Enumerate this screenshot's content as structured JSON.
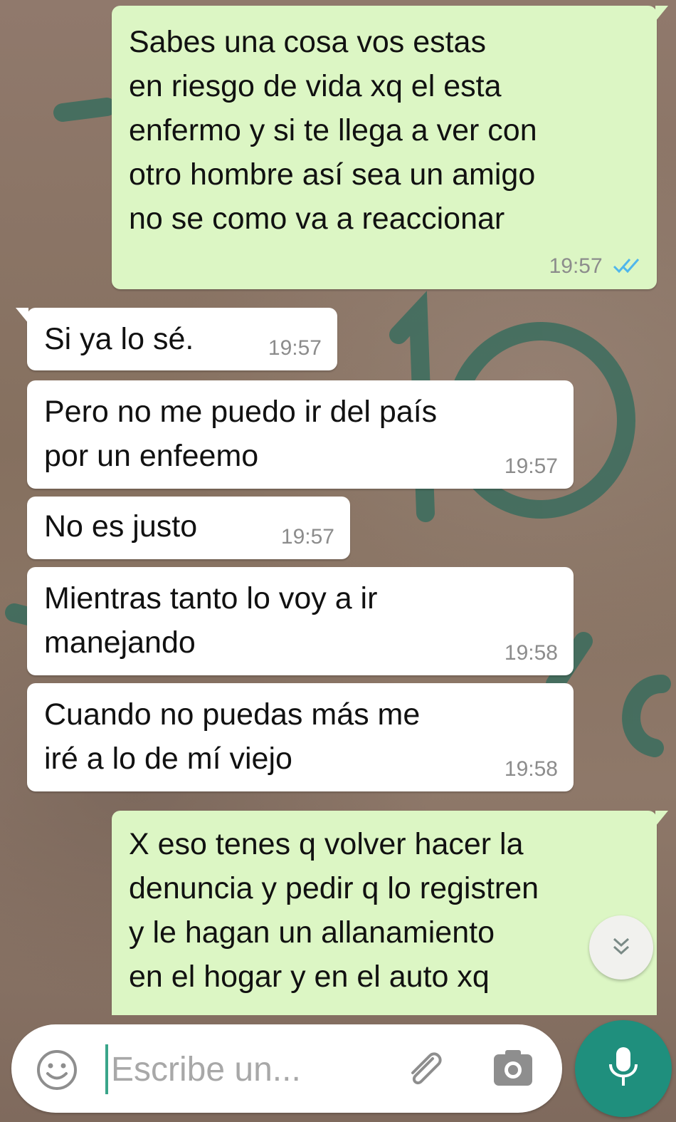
{
  "colors": {
    "outgoing_bubble": "#dcf6c4",
    "incoming_bubble": "#ffffff",
    "accent": "#1f8f7d",
    "read_ticks": "#4fb6ec",
    "time_text": "#8c8c8c"
  },
  "messages": [
    {
      "direction": "outgoing",
      "text": "Sabes una cosa vos estas\nen riesgo de vida xq el esta\nenfermo y si te llega a ver con\notro hombre así sea un amigo\nno se como va a reaccionar",
      "time": "19:57",
      "status_icon": "double-check-read-icon"
    },
    {
      "direction": "incoming",
      "text": "Si ya lo sé.",
      "time": "19:57"
    },
    {
      "direction": "incoming",
      "text": "Pero no me puedo ir del país\npor un enfeemo",
      "time": "19:57"
    },
    {
      "direction": "incoming",
      "text": "No es justo",
      "time": "19:57"
    },
    {
      "direction": "incoming",
      "text": "Mientras tanto lo voy a ir\nmanejando",
      "time": "19:58"
    },
    {
      "direction": "incoming",
      "text": "Cuando no puedas más me\niré a lo de mí viejo",
      "time": "19:58"
    },
    {
      "direction": "outgoing",
      "text": "X eso tenes q volver hacer la\ndenuncia y pedir q lo registren\ny le hagan un allanamiento\nen el hogar y en el auto xq"
    }
  ],
  "scroll_button": {
    "icon": "double-chevron-down-icon"
  },
  "composer": {
    "placeholder": "Escribe un...",
    "value": "",
    "emoji_icon": "emoji-icon",
    "attach_icon": "paperclip-icon",
    "camera_icon": "camera-icon",
    "mic_icon": "microphone-icon"
  }
}
